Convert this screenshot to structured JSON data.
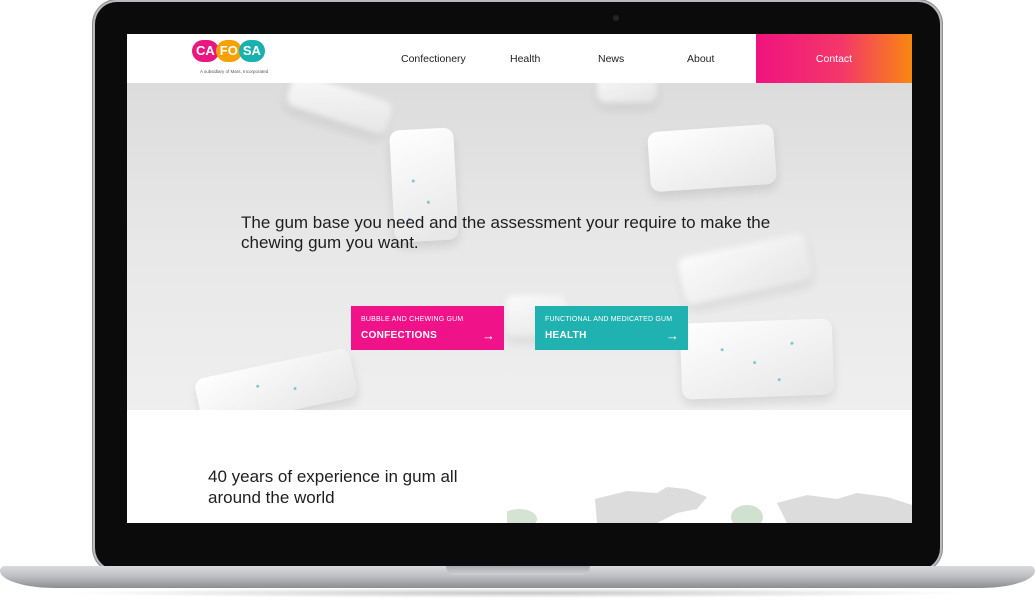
{
  "brand": {
    "letters": [
      {
        "text": "CA",
        "color": "#e9177f"
      },
      {
        "text": "FO",
        "color": "#f6a100"
      },
      {
        "text": "SA",
        "color": "#19b0b0"
      }
    ],
    "tagline": "A subsidiary of Mars, Incorporated"
  },
  "nav": {
    "items": [
      "Confectionery",
      "Health",
      "News",
      "About"
    ],
    "contact": "Contact"
  },
  "hero": {
    "headline": "The gum base you need and the assessment your require to make the chewing gum you want.",
    "cta_confections": {
      "small": "BUBBLE AND CHEWING GUM",
      "big": "CONFECTIONS",
      "arrow": "→",
      "color": "#f01289"
    },
    "cta_health": {
      "small": "FUNCTIONAL AND MEDICATED GUM",
      "big": "HEALTH",
      "arrow": "→",
      "color": "#1fb2b1"
    }
  },
  "section": {
    "title": "40 years of experience in gum all around the world"
  },
  "colors": {
    "contact_gradient_start": "#f0137e",
    "contact_gradient_end": "#f8880f",
    "laptop_bezel": "#0b0b0c"
  }
}
